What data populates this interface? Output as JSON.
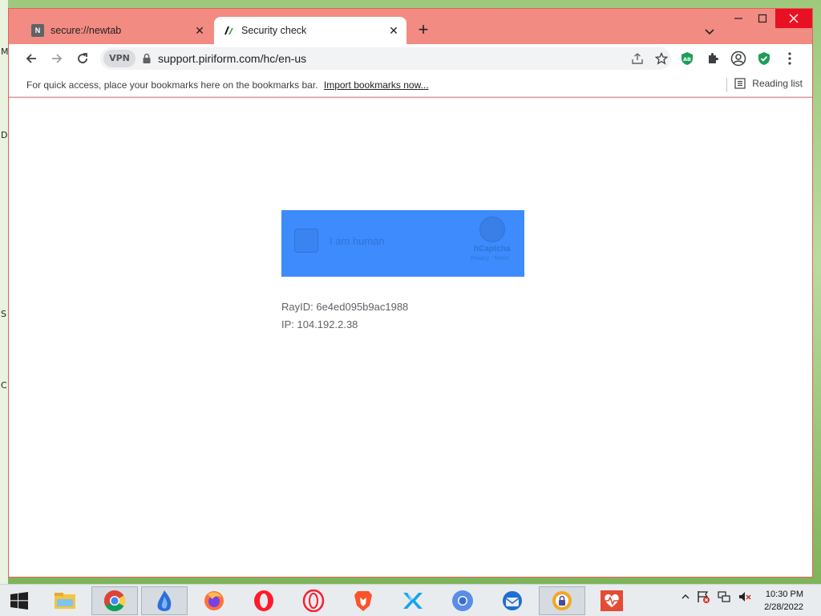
{
  "desktop": {
    "side_letters": [
      "M",
      "D",
      "S",
      "C"
    ]
  },
  "tabs": [
    {
      "title": "secure://newtab",
      "favicon_letter": "N",
      "active": false
    },
    {
      "title": "Security check",
      "active": true
    }
  ],
  "toolbar": {
    "vpn_label": "VPN",
    "url": "support.piriform.com/hc/en-us",
    "extension_badge": "AB"
  },
  "bookmarks_bar": {
    "message": "For quick access, place your bookmarks here on the bookmarks bar.",
    "import_link": "Import bookmarks now...",
    "reading_list": "Reading list"
  },
  "captcha": {
    "checkbox_label": "I am human",
    "brand": "hCaptcha",
    "legal": "Privacy - Terms",
    "color": "#3d8bfd"
  },
  "page_info": {
    "ray_id": "RayID: 6e4ed095b9ac1988",
    "ip": "IP: 104.192.2.38"
  },
  "taskbar": {
    "apps": [
      "file-explorer",
      "chrome",
      "app-blue-flame",
      "firefox",
      "opera",
      "opera-gx",
      "brave",
      "app-x",
      "chromium",
      "thunderbird",
      "secure-browser",
      "health-app"
    ],
    "time": "10:30 PM",
    "date": "2/28/2022"
  }
}
